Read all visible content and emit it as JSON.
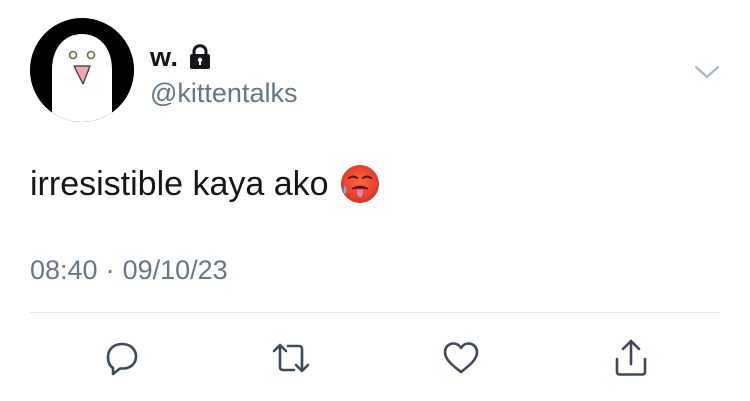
{
  "user": {
    "display_name": "w.",
    "handle": "@kittentalks",
    "protected_icon": "lock-icon",
    "avatar": "ghost-avatar"
  },
  "tweet": {
    "text": "irresistible kaya ako",
    "emoji": "hot-face-emoji",
    "time": "08:40",
    "separator": "·",
    "date": "09/10/23"
  },
  "menu": {
    "icon": "chevron-down-icon"
  },
  "actions": [
    {
      "name": "reply",
      "icon": "reply-icon"
    },
    {
      "name": "retweet",
      "icon": "retweet-icon"
    },
    {
      "name": "like",
      "icon": "heart-icon"
    },
    {
      "name": "share",
      "icon": "share-icon"
    }
  ],
  "colors": {
    "text": "#14171a",
    "secondary": "#657786",
    "divider": "#e1e8ed",
    "icon": "#3d4a5c"
  }
}
